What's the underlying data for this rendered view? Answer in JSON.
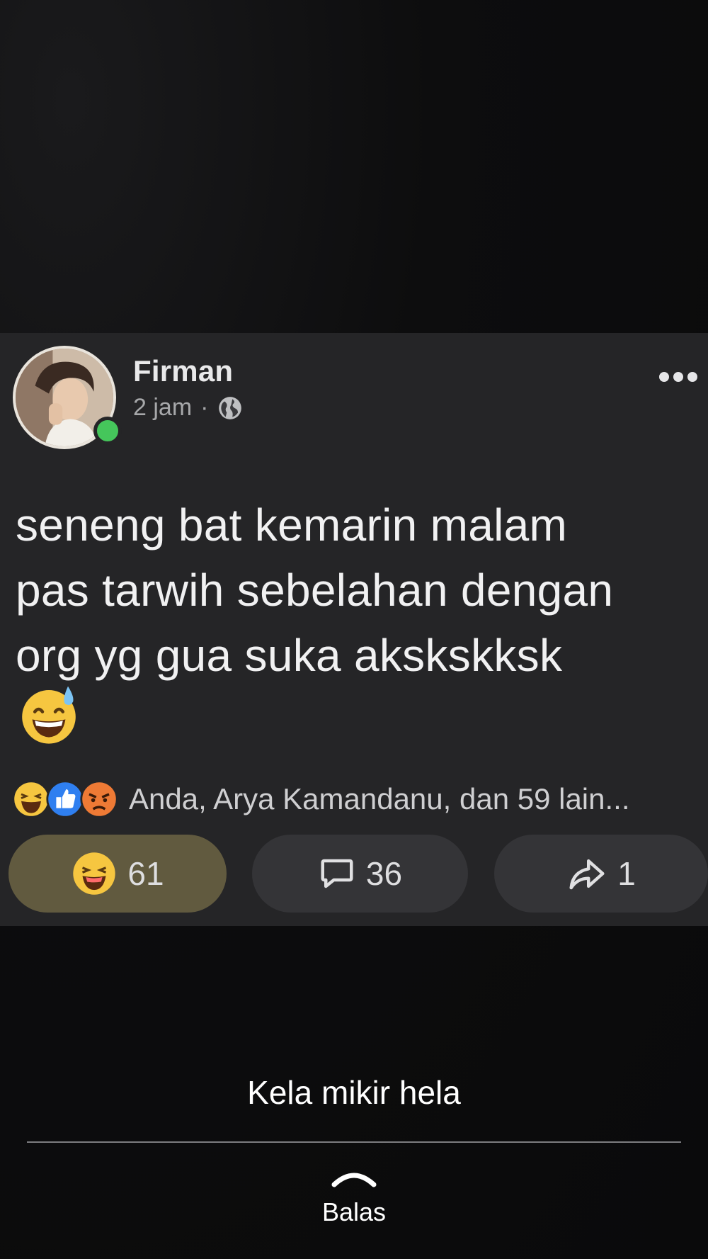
{
  "post": {
    "author": "Firman",
    "time": "2 jam",
    "separator": "·",
    "audience_icon": "globe-icon",
    "more_icon": "more-options-icon",
    "text_lines": [
      "seneng bat kemarin malam",
      "pas tarwih sebelahan dengan",
      "org yg gua suka akskskksk"
    ],
    "emoji_icon": "grinning-sweat-emoji-icon",
    "reactions": {
      "icons": [
        "haha-reaction-icon",
        "like-reaction-icon",
        "angry-reaction-icon"
      ],
      "summary": "Anda, Arya Kamandanu, dan 59 lain..."
    },
    "actions": {
      "haha_count": "61",
      "comment_count": "36",
      "share_count": "1"
    }
  },
  "story": {
    "caption": "Kela mikir hela",
    "reply_label": "Balas"
  },
  "colors": {
    "background": "#0c0c0d",
    "card": "#252527",
    "haha_button": "#615a3f",
    "action_button": "#343437",
    "online": "#45c65b"
  }
}
